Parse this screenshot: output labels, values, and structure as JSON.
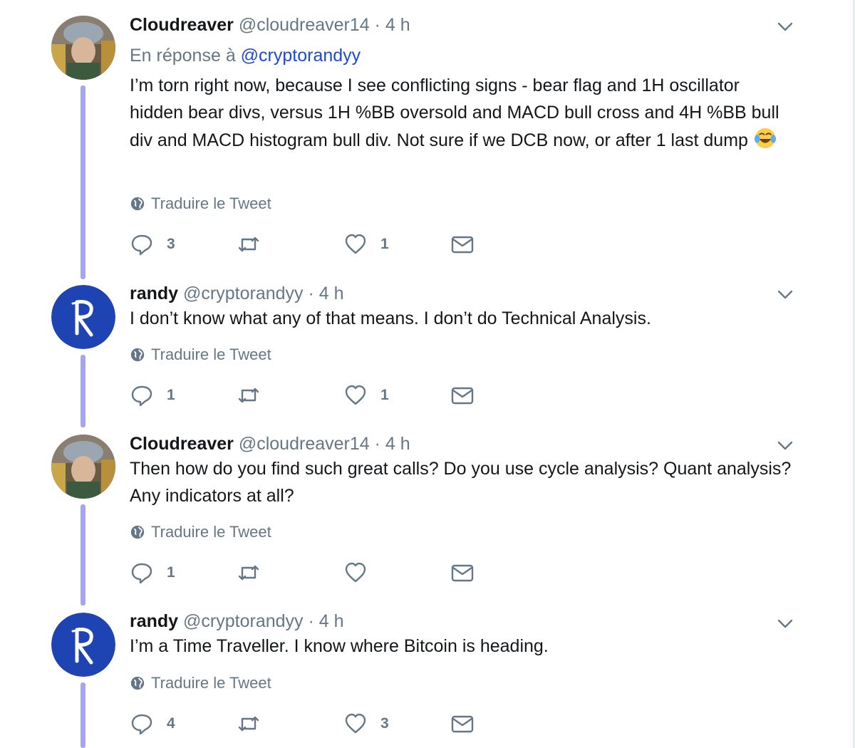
{
  "tweets": [
    {
      "name": "Cloudreaver",
      "handle": "@cloudreaver14",
      "dot": "·",
      "time": "4 h",
      "reply_prefix": "En réponse à",
      "reply_mention": "@cryptorandyy",
      "text": "I’m torn right now, because I see conflicting signs - bear flag and 1H oscillator hidden bear divs, versus 1H %BB oversold and MACD bull cross and 4H %BB bull div and MACD histogram bull div. Not sure if we DCB now, or after 1 last dump",
      "emoji": "face-with-tears-of-joy",
      "translate": "Traduire le Tweet",
      "replies": "3",
      "retweets": "",
      "likes": "1"
    },
    {
      "name": "randy",
      "handle": "@cryptorandyy",
      "dot": "·",
      "time": "4 h",
      "text": "I don’t know what any of that means. I don’t do Technical Analysis.",
      "translate": "Traduire le Tweet",
      "replies": "1",
      "retweets": "",
      "likes": "1"
    },
    {
      "name": "Cloudreaver",
      "handle": "@cloudreaver14",
      "dot": "·",
      "time": "4 h",
      "text": "Then how do you find such great calls? Do you use cycle analysis? Quant analysis? Any indicators at all?",
      "translate": "Traduire le Tweet",
      "replies": "1",
      "retweets": "",
      "likes": ""
    },
    {
      "name": "randy",
      "handle": "@cryptorandyy",
      "dot": "·",
      "time": "4 h",
      "text": "I’m a Time Traveller. I know where Bitcoin is heading.",
      "translate": "Traduire le Tweet",
      "replies": "4",
      "retweets": "",
      "likes": "3"
    }
  ],
  "icons": {
    "reply": "reply-icon",
    "retweet": "retweet-icon",
    "like": "heart-icon",
    "dm": "envelope-icon",
    "more": "chevron-down-icon",
    "globe": "globe-icon"
  },
  "colors": {
    "thread_line": "#a7a4f0",
    "link": "#1b4bd6",
    "muted": "#657786",
    "randy_avatar_bg": "#1e44b4"
  }
}
